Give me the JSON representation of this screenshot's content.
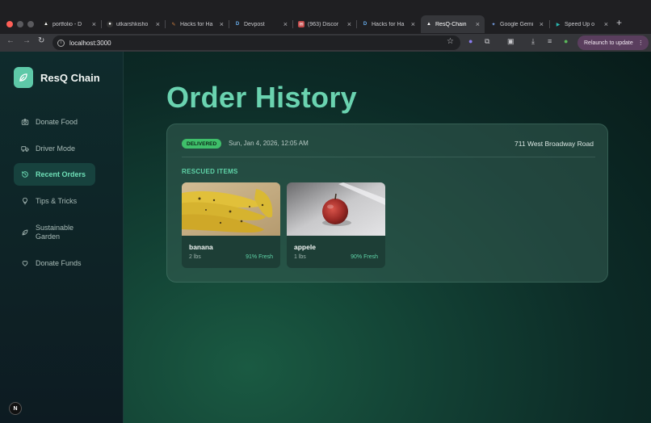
{
  "browser": {
    "tabs": [
      {
        "title": "portfolio - D",
        "favicon": "A",
        "fav_color": "#222"
      },
      {
        "title": "utkarshkisho",
        "favicon": "github-icon",
        "fav_color": "#333"
      },
      {
        "title": "Hacks for Ha",
        "favicon": "pencil-icon",
        "fav_color": "#a0522d"
      },
      {
        "title": "Devpost",
        "favicon": "D",
        "fav_color": "#1d5c8f"
      },
      {
        "title": "(963) Discor",
        "favicon": "mail-icon",
        "fav_color": "#c54b4b"
      },
      {
        "title": "Hacks for Ha",
        "favicon": "D",
        "fav_color": "#1d5c8f"
      },
      {
        "title": "ResQ-Chain",
        "favicon": "A",
        "fav_color": "#222"
      },
      {
        "title": "Google Gemi",
        "favicon": "gemini-icon",
        "fav_color": "#4a7bd0"
      },
      {
        "title": "Speed Up o",
        "favicon": "play-icon",
        "fav_color": "#2aa6a0"
      }
    ],
    "active_tab": 6,
    "url": "localhost:3000",
    "relaunch_label": "Relaunch to update"
  },
  "sidebar": {
    "brand": "ResQ Chain",
    "items": [
      {
        "label": "Donate Food",
        "icon": "camera-icon"
      },
      {
        "label": "Driver Mode",
        "icon": "truck-icon"
      },
      {
        "label": "Recent Orders",
        "icon": "history-icon"
      },
      {
        "label": "Tips & Tricks",
        "icon": "lightbulb-icon"
      },
      {
        "label": "Sustainable Garden",
        "icon": "leaf-icon"
      },
      {
        "label": "Donate Funds",
        "icon": "heart-icon"
      }
    ],
    "active_index": 2,
    "footer_badge": "N"
  },
  "main": {
    "title": "Order History",
    "order": {
      "status": "DELIVERED",
      "date": "Sun, Jan 4, 2026, 12:05 AM",
      "address": "711 West Broadway Road",
      "section_label": "RESCUED ITEMS",
      "items": [
        {
          "name": "banana",
          "weight": "2 lbs",
          "fresh": "91% Fresh"
        },
        {
          "name": "appele",
          "weight": "1 lbs",
          "fresh": "90% Fresh"
        }
      ]
    }
  },
  "colors": {
    "accent": "#6ad3b0",
    "badge": "#3fbf6a",
    "active_nav_bg": "#17423e"
  }
}
